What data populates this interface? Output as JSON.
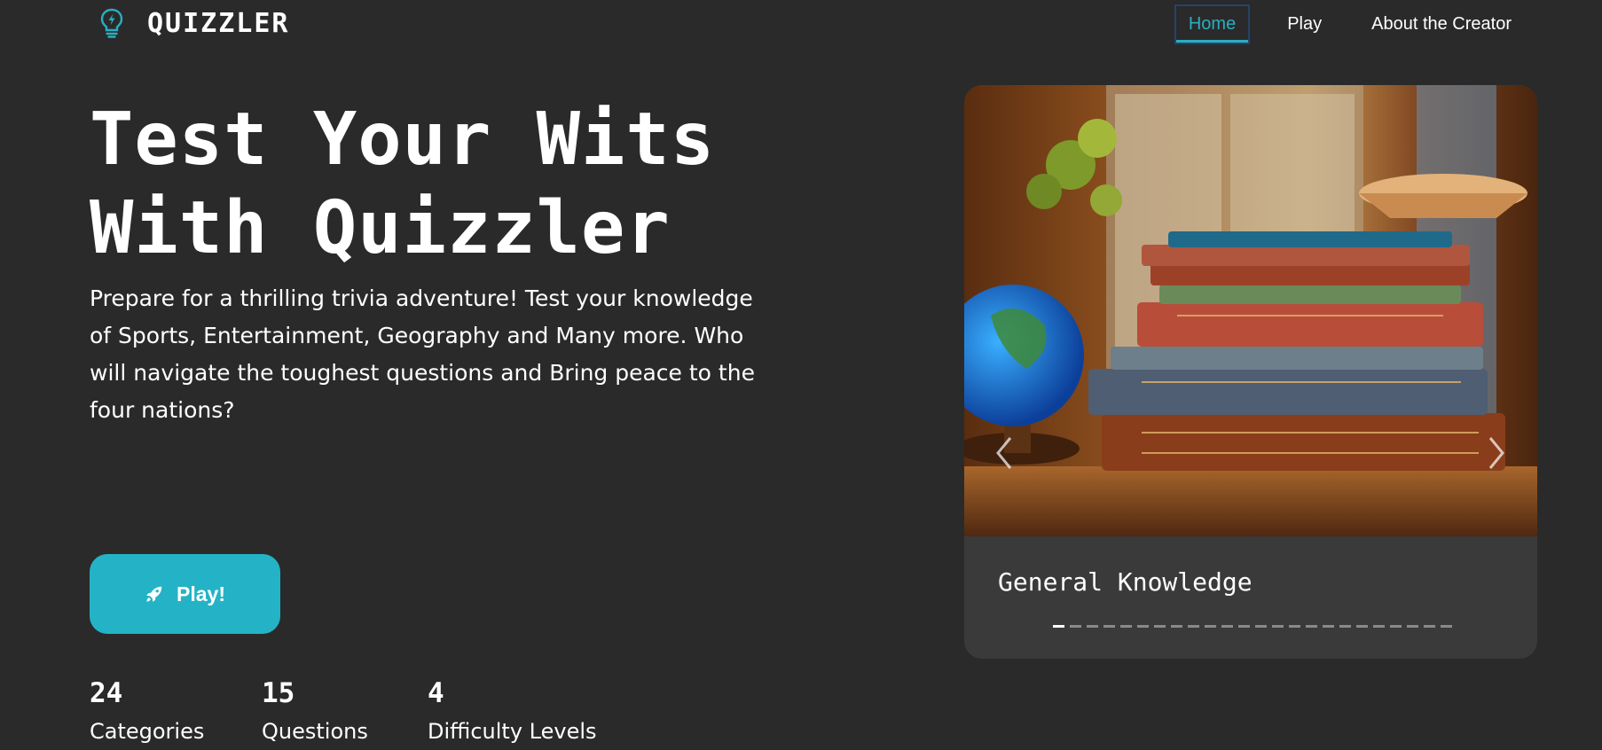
{
  "brand": {
    "name": "QUIZZLER",
    "icon": "lightbulb-icon",
    "accent": "#2aaec2"
  },
  "nav": {
    "items": [
      {
        "label": "Home",
        "active": true
      },
      {
        "label": "Play",
        "active": false
      },
      {
        "label": "About the Creator",
        "active": false
      }
    ]
  },
  "hero": {
    "title_line1": "Test Your Wits",
    "title_line2": "With Quizzler",
    "description": "Prepare for a thrilling trivia adventure! Test your knowledge of Sports, Entertainment, Geography and Many more. Who will navigate the toughest questions and Bring peace to the four nations?",
    "play_button": {
      "label": "Play!",
      "icon": "rocket-icon",
      "color": "#24b3c6"
    }
  },
  "stats": [
    {
      "value": "24",
      "label": "Categories"
    },
    {
      "value": "15",
      "label": "Questions"
    },
    {
      "value": "4",
      "label": "Difficulty Levels"
    }
  ],
  "carousel": {
    "caption": "General Knowledge",
    "image": "stack-of-books-with-globe",
    "slide_count": 24,
    "active_slide": 1
  },
  "colors": {
    "background": "#2a2a2a",
    "card": "#3a3a3a",
    "accent": "#24b3c6"
  }
}
